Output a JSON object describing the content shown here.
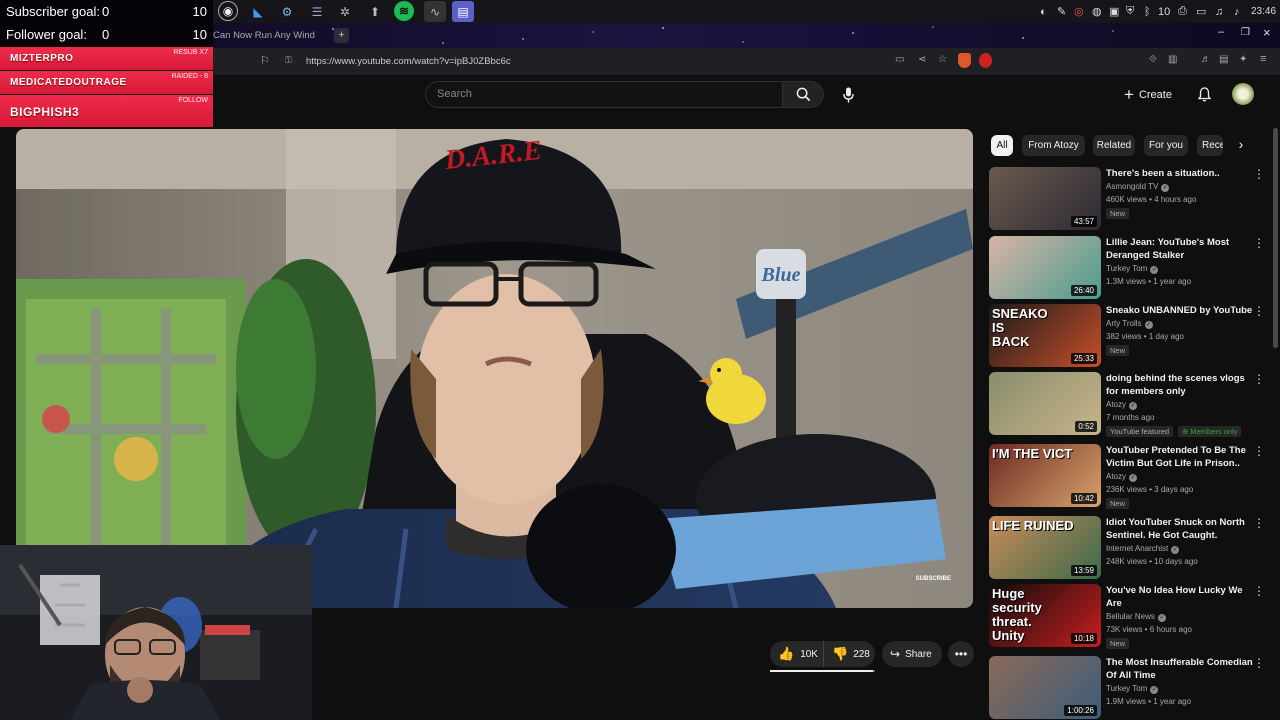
{
  "taskbar": {
    "clock": "23:46",
    "volume_level": "10"
  },
  "overlay": {
    "subscriber_goal": {
      "label": "Subscriber goal:",
      "current": "0",
      "target": "10"
    },
    "follower_goal": {
      "label": "Follower goal:",
      "current": "0",
      "target": "10"
    },
    "alerts": [
      {
        "name": "MIZTERPRO",
        "tag": "RESUB X7"
      },
      {
        "name": "MEDICATEDOUTRAGE",
        "tag": "RAIDED - 8"
      },
      {
        "name": "BIGPHISH3",
        "tag": "FOLLOW"
      }
    ]
  },
  "browser": {
    "tab_title": "Can Now Run Any Wind",
    "url": "https://www.youtube.com/watch?v=ipBJ0ZBbc6c"
  },
  "youtube": {
    "search_placeholder": "Search",
    "create_label": "Create",
    "chips": [
      "All",
      "From Atozy",
      "Related",
      "For you",
      "Rece"
    ],
    "video_overlay_text": "SUBSCRIBE",
    "actions": {
      "likes": "10K",
      "dislikes": "228",
      "share": "Share"
    },
    "recommendations": [
      {
        "title": "There's been a situation..",
        "channel": "Asmongold TV",
        "meta": "460K views • 4 hours ago",
        "badge": "New",
        "duration": "43:57",
        "colors": [
          "#6b5a4d",
          "#2c2a33"
        ]
      },
      {
        "title": "Lillie Jean: YouTube's Most Deranged Stalker",
        "channel": "Turkey Tom",
        "meta": "1.3M views • 1 year ago",
        "badge": "",
        "duration": "26:40",
        "colors": [
          "#d8b4a6",
          "#4a9c8f"
        ]
      },
      {
        "title": "Sneako UNBANNED by YouTube",
        "channel": "Arty Trolls",
        "meta": "382 views • 1 day ago",
        "badge": "New",
        "duration": "25:33",
        "colors": [
          "#1a1a1a",
          "#c94f2a"
        ],
        "thumb_text": [
          "SNEAKO",
          "IS",
          "BACK"
        ]
      },
      {
        "title": "doing behind the scenes vlogs for members only",
        "channel": "Atozy",
        "meta": "7 months ago",
        "badge": "",
        "duration": "0:52",
        "colors": [
          "#8a8d6c",
          "#c7b48a"
        ],
        "extra_left": "YouTube featured",
        "extra_right": "Members only"
      },
      {
        "title": "YouTuber Pretended To Be The Victim But Got Life in Prison..",
        "channel": "Atozy",
        "meta": "236K views • 3 days ago",
        "badge": "New",
        "duration": "10:42",
        "colors": [
          "#6b2a22",
          "#d9a36c"
        ],
        "thumb_text": [
          "I'M THE VICT"
        ]
      },
      {
        "title": "Idiot YouTuber Snuck on North Sentinel. He Got Caught.",
        "channel": "Internet Anarchist",
        "meta": "248K views • 10 days ago",
        "badge": "",
        "duration": "13:59",
        "colors": [
          "#c98a5a",
          "#3a6b4a"
        ],
        "thumb_text": [
          "LIFE RUINED"
        ]
      },
      {
        "title": "You've No Idea How Lucky We Are",
        "channel": "Bellular News",
        "meta": "73K views • 6 hours ago",
        "badge": "New",
        "duration": "10:18",
        "colors": [
          "#0c0c0c",
          "#c81e1e"
        ],
        "thumb_text": [
          "Huge",
          "security",
          "threat.",
          "Unity"
        ]
      },
      {
        "title": "The Most Insufferable Comedian Of All Time",
        "channel": "Turkey Tom",
        "meta": "1.9M views • 1 year ago",
        "badge": "",
        "duration": "1:00:26",
        "colors": [
          "#8a6a58",
          "#3d5d7a"
        ]
      }
    ]
  }
}
